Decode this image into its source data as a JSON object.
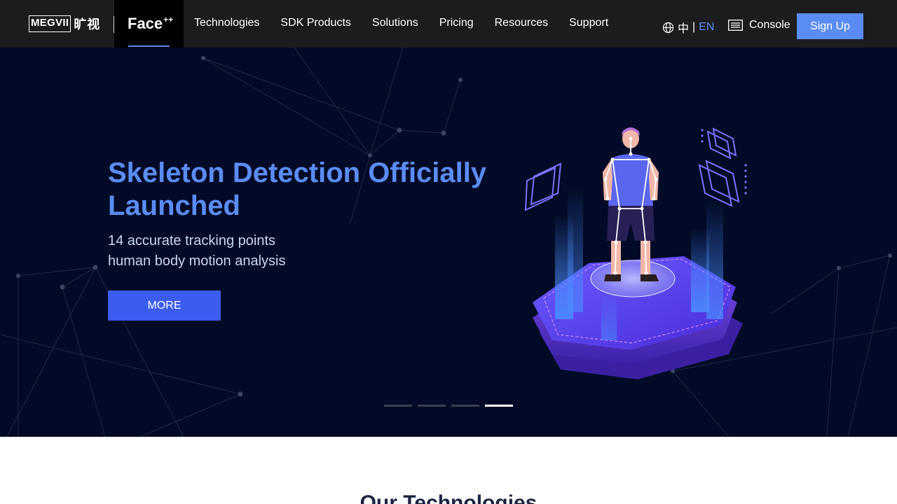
{
  "header": {
    "logo_text": "MEGVII",
    "logo_cn": "旷视",
    "product": "Face",
    "product_sup": "++",
    "nav": [
      "Technologies",
      "SDK Products",
      "Solutions",
      "Pricing",
      "Resources",
      "Support"
    ],
    "lang_zh": "中",
    "lang_sep": "|",
    "lang_en": "EN",
    "console_label": "Console",
    "signup_label": "Sign Up"
  },
  "hero": {
    "title": "Skeleton Detection Officially Launched",
    "subtitle_line1": "14 accurate tracking points",
    "subtitle_line2": "human body motion analysis",
    "more_label": "MORE",
    "slides_total": 4,
    "active_slide": 4
  },
  "section": {
    "title": "Our Technologies"
  },
  "colors": {
    "header_bg": "#1c1c1f",
    "hero_bg": "#010a26",
    "accent": "#5a8cf4",
    "button_blue": "#3c5cf0"
  },
  "icons": [
    "globe-icon",
    "console-icon"
  ]
}
